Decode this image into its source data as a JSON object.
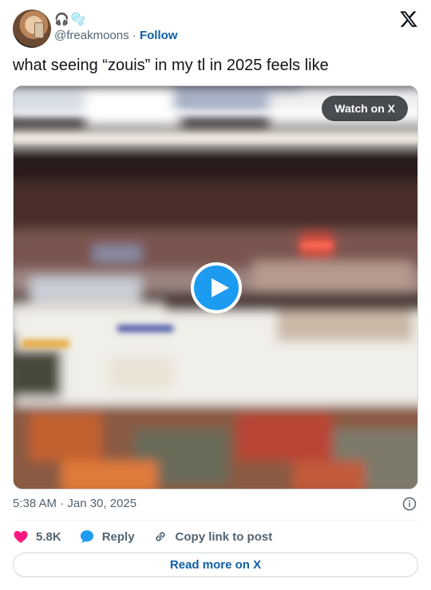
{
  "user": {
    "display_name_emoji": [
      "🎧",
      "🫧"
    ],
    "handle": "@freakmoons",
    "separator": " · ",
    "follow_label": "Follow",
    "avatar_icon": "avatar-photo"
  },
  "tweet": {
    "text": "what seeing “zouis” in my tl in 2025 feels like"
  },
  "media": {
    "type": "video",
    "watch_label": "Watch on X",
    "play_icon": "play-icon",
    "accent_color": "#1d9bf0"
  },
  "meta": {
    "timestamp": "5:38 AM · Jan 30, 2025",
    "info_icon": "info-icon"
  },
  "actions": [
    {
      "icon": "heart-icon",
      "label": "5.8K",
      "color": "#f91880"
    },
    {
      "icon": "reply-icon",
      "label": "Reply",
      "color": "#1d9bf0"
    },
    {
      "icon": "link-icon",
      "label": "Copy link to post",
      "color": "#536471"
    }
  ],
  "footer": {
    "read_more_label": "Read more on X"
  },
  "colors": {
    "link": "#0f5fa8",
    "muted_text": "#536471",
    "border": "#cfd9de"
  }
}
